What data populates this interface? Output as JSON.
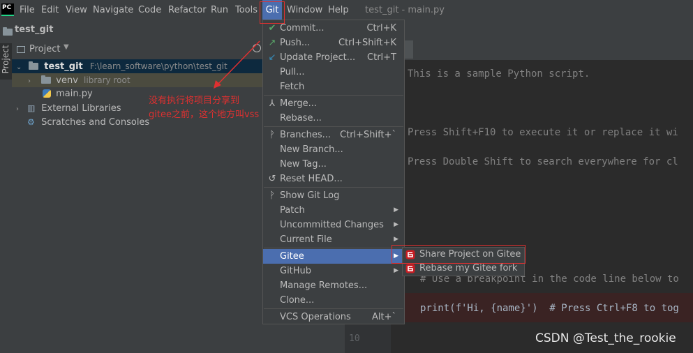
{
  "menubar": {
    "logo_text": "PC",
    "items": [
      "File",
      "Edit",
      "View",
      "Navigate",
      "Code",
      "Refactor",
      "Run",
      "Tools",
      "Git",
      "Window",
      "Help"
    ],
    "window_title": "test_git - main.py"
  },
  "navbar": {
    "project": "test_git"
  },
  "stripe": {
    "label": "Project"
  },
  "panel": {
    "header": "Project",
    "tree": [
      {
        "name": "test_git",
        "path": "F:\\learn_software\\python\\test_git"
      },
      {
        "name": "venv",
        "note": "library root"
      },
      {
        "name": "main.py"
      },
      {
        "name": "External Libraries"
      },
      {
        "name": "Scratches and Consoles"
      }
    ],
    "annotation_line1": "没有执行将项目分享到",
    "annotation_line2": "gitee之前，这个地方叫vss"
  },
  "editor": {
    "lines": [
      "This is a sample Python script.",
      "Press Shift+F10 to execute it or replace it wi",
      "Press Double Shift to search everywhere for cl",
      "# Use a breakpoint in the code line below to",
      "print(f'Hi, {name}')  # Press Ctrl+F8 to tog"
    ],
    "line_number": "10"
  },
  "git_menu": {
    "items": [
      {
        "label": "Commit...",
        "shortcut": "Ctrl+K",
        "icon": "check-icon"
      },
      {
        "label": "Push...",
        "shortcut": "Ctrl+Shift+K",
        "icon": "push-arrow-icon"
      },
      {
        "label": "Update Project...",
        "shortcut": "Ctrl+T",
        "icon": "update-arrow-icon"
      },
      {
        "label": "Pull...",
        "shortcut": ""
      },
      {
        "label": "Fetch",
        "shortcut": ""
      },
      {
        "label": "Merge...",
        "shortcut": "",
        "icon": "merge-icon"
      },
      {
        "label": "Rebase...",
        "shortcut": ""
      },
      {
        "label": "Branches...",
        "shortcut": "Ctrl+Shift+`",
        "icon": "branch-icon"
      },
      {
        "label": "New Branch...",
        "shortcut": ""
      },
      {
        "label": "New Tag...",
        "shortcut": ""
      },
      {
        "label": "Reset HEAD...",
        "shortcut": "",
        "icon": "undo-icon"
      },
      {
        "label": "Show Git Log",
        "shortcut": "",
        "icon": "log-icon"
      },
      {
        "label": "Patch",
        "shortcut": ""
      },
      {
        "label": "Uncommitted Changes",
        "shortcut": ""
      },
      {
        "label": "Current File",
        "shortcut": ""
      },
      {
        "label": "Gitee",
        "shortcut": ""
      },
      {
        "label": "GitHub",
        "shortcut": ""
      },
      {
        "label": "Manage Remotes...",
        "shortcut": ""
      },
      {
        "label": "Clone...",
        "shortcut": ""
      },
      {
        "label": "VCS Operations",
        "shortcut": "Alt+`"
      }
    ]
  },
  "gitee_menu": {
    "items": [
      "Share Project on Gitee",
      "Rebase my Gitee fork"
    ]
  },
  "watermark": "CSDN @Test_the_rookie",
  "colors": {
    "accent": "#4b6eaf",
    "annotation": "#e03030",
    "gitee": "#c71d23"
  }
}
